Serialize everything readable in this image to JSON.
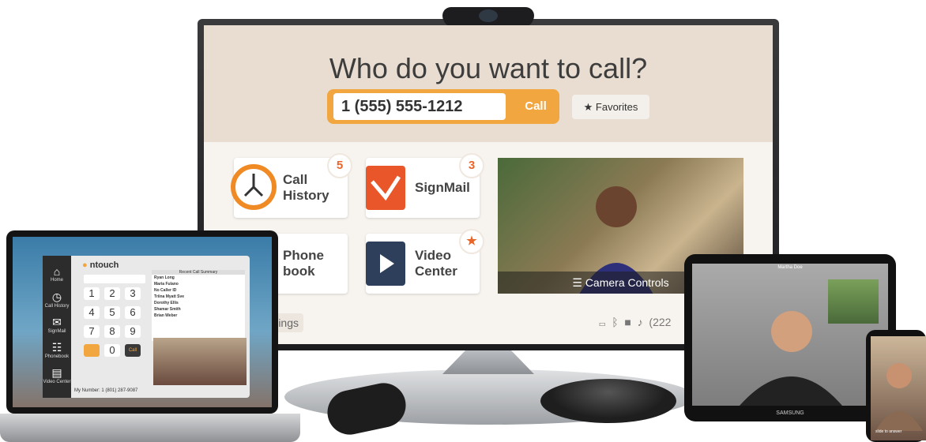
{
  "tv": {
    "headline": "Who do you want to call?",
    "dial_value": "1 (555) 555-1212",
    "call_label": "Call",
    "favorites_label": "Favorites",
    "tiles": [
      {
        "label": "Call\nHistory",
        "badge": "5"
      },
      {
        "label": "SignMail",
        "badge": "3"
      },
      {
        "label": "Phone\nbook",
        "badge": ""
      },
      {
        "label": "Video\nCenter",
        "badge": "★"
      }
    ],
    "camera_controls_label": "Camera Controls",
    "settings_partial": "ings",
    "status_partial": "(222"
  },
  "laptop": {
    "app_brand": "ntouch",
    "sidebar": [
      "Home",
      "Call History",
      "SignMail",
      "Phonebook",
      "Video Center"
    ],
    "keypad": [
      "1",
      "2",
      "3",
      "4",
      "5",
      "6",
      "7",
      "8",
      "9",
      "",
      "0",
      "Call"
    ],
    "panel_title": "Recent Call Summary",
    "contacts": [
      "Ryan Long",
      "Maria Fulano",
      "No Caller ID",
      "Triina Myatt Sve",
      "Dorothy Ellis",
      "Shamar Smith",
      "Brian Weber"
    ],
    "footer": "My Number: 1 (801) 287-9087"
  },
  "tablet": {
    "brand": "SAMSUNG",
    "caller": "Martha Doe"
  },
  "phone": {
    "label": "slide to answer"
  },
  "colors": {
    "accent": "#f2a640",
    "badge_red": "#e8662a",
    "tv_header": "#e8ddd0"
  }
}
